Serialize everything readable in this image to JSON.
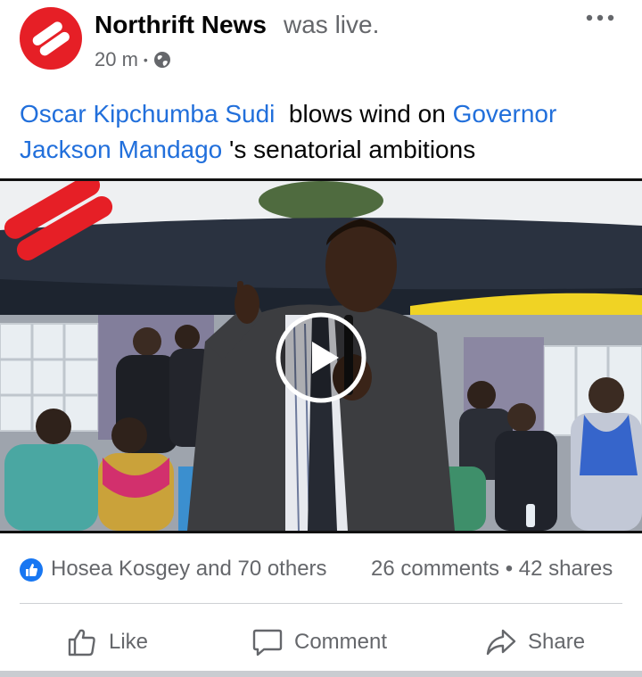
{
  "post": {
    "page_name": "Northrift News",
    "status_text": "was live.",
    "time": "20 m",
    "separator": "•",
    "audience_icon": "globe-icon",
    "more_icon": "more-dots-icon"
  },
  "caption": {
    "mention_1": "Oscar Kipchumba Sudi",
    "text_1": "  blows wind on ",
    "mention_2": "Governor Jackson Mandago",
    "text_2": " 's senatorial ambitions"
  },
  "video": {
    "play_icon": "play-icon",
    "logo_icon": "northrift-logo-icon"
  },
  "reactions": {
    "reactors_text": "Hosea Kosgey and 70 others",
    "counts_text": "26 comments • 42 shares",
    "reaction_icon": "like-reaction-icon"
  },
  "actions": {
    "like_label": "Like",
    "comment_label": "Comment",
    "share_label": "Share"
  },
  "colors": {
    "brand_red": "#e61f26",
    "link_blue": "#216fdb",
    "meta_gray": "#65676b"
  }
}
